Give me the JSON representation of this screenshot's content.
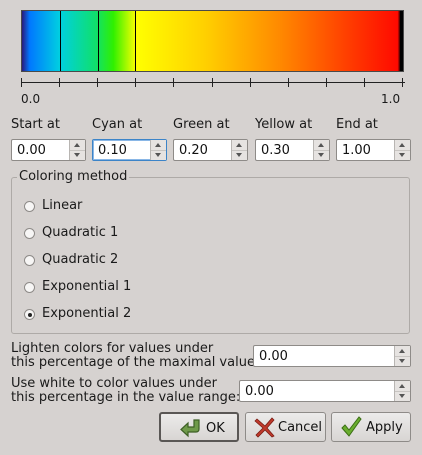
{
  "gradient": {
    "tick_min_label": "0.0",
    "tick_max_label": "1.0",
    "tick_count": 11,
    "markers": [
      0.1,
      0.2,
      0.3
    ]
  },
  "positions": [
    {
      "label": "Start at",
      "value": "0.00",
      "focused": false
    },
    {
      "label": "Cyan at",
      "value": "0.10",
      "focused": true
    },
    {
      "label": "Green at",
      "value": "0.20",
      "focused": false
    },
    {
      "label": "Yellow at",
      "value": "0.30",
      "focused": false
    },
    {
      "label": "End at",
      "value": "1.00",
      "focused": false
    }
  ],
  "coloring_method": {
    "title": "Coloring method",
    "options": [
      "Linear",
      "Quadratic 1",
      "Quadratic 2",
      "Exponential 1",
      "Exponential 2"
    ],
    "selected": "Exponential 2"
  },
  "lighten": {
    "label_line1": "Lighten colors for values under",
    "label_line2": "this percentage of the maximal value:",
    "value": "0.00"
  },
  "white": {
    "label_line1": "Use white to color values under",
    "label_line2": "this percentage in the value range:",
    "value": "0.00"
  },
  "buttons": {
    "ok": "OK",
    "cancel": "Cancel",
    "apply": "Apply"
  },
  "colors": {
    "ok_icon": "#5a8a3a",
    "cancel_icon": "#c0392b",
    "apply_icon": "#4e9a06"
  },
  "icons": {
    "ok": "ok-arrow-icon",
    "cancel": "cancel-x-icon",
    "apply": "apply-check-icon"
  }
}
